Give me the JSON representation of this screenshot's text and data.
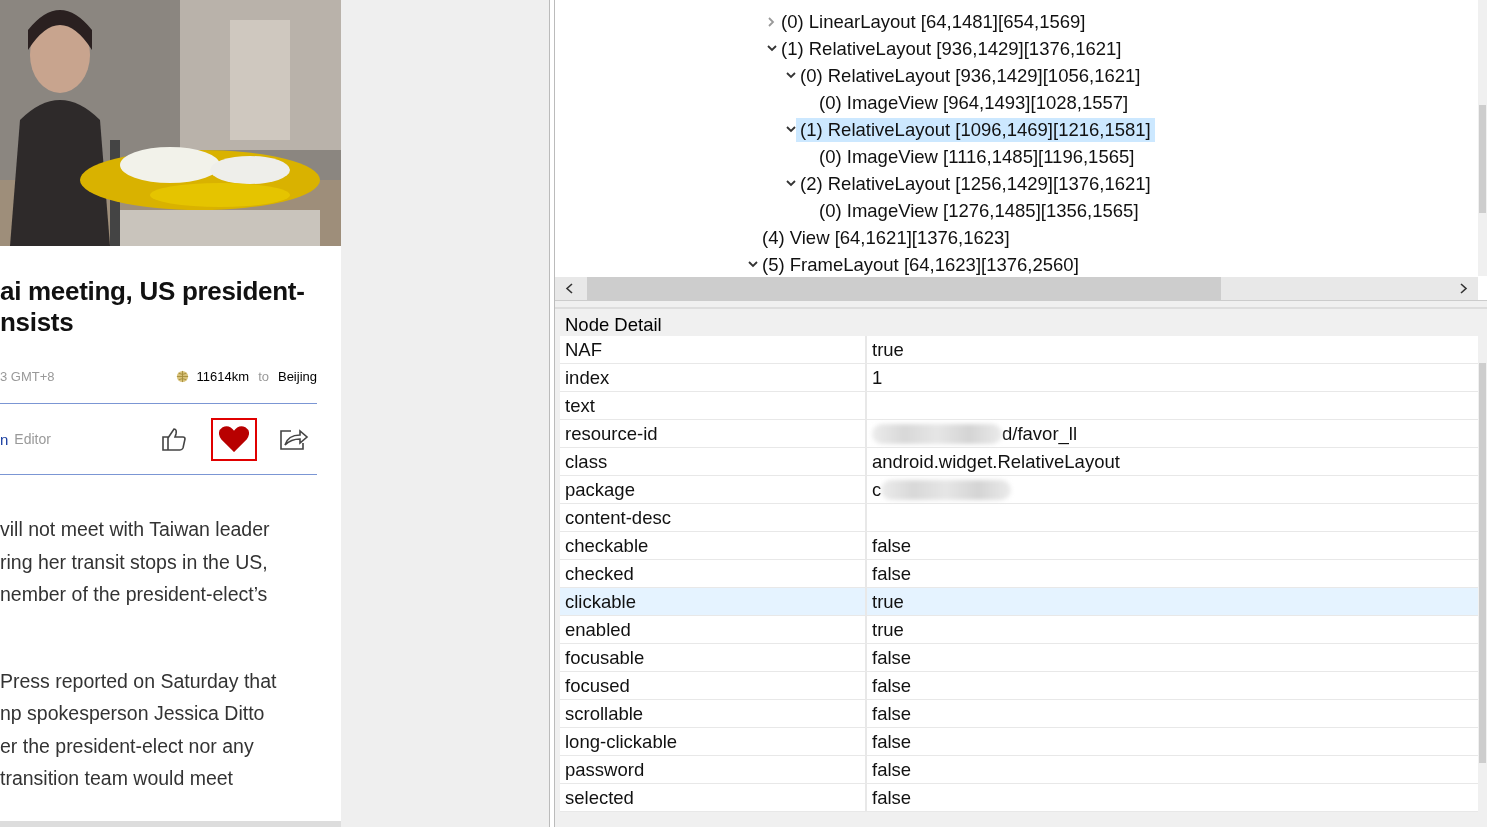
{
  "article": {
    "picture": {
      "kind": "picture"
    },
    "headline": [
      "ai meeting, US president-",
      "nsists"
    ],
    "meta": {
      "time": "3 GMT+8",
      "distance": "11614km",
      "to": "to",
      "city": "Beijing"
    },
    "author": {
      "name": "n",
      "role": "Editor"
    },
    "actions": [
      {
        "kind": "like",
        "selected": false
      },
      {
        "kind": "favorite",
        "selected": true
      },
      {
        "kind": "share",
        "selected": false
      }
    ],
    "paragraphs": [
      {
        "lines": [
          "vill not meet with Taiwan leader",
          "ring her transit stops in the US,",
          "nember of the president-elect’s"
        ]
      },
      {
        "lines": [
          "Press reported on Saturday that",
          "np spokesperson Jessica Ditto",
          "er the president-elect nor any",
          "transition team would meet"
        ]
      }
    ]
  },
  "tree": {
    "nodes": [
      {
        "children": [
          {
            "label": "(0) LinearLayout [64,1481][654,1569]",
            "expanded": false,
            "selected": false
          },
          {
            "label": "(1) RelativeLayout [936,1429][1376,1621]",
            "expanded": true,
            "selected": false,
            "children": [
              {
                "label": "(0) RelativeLayout [936,1429][1056,1621]",
                "expanded": true,
                "selected": false,
                "children": [
                  {
                    "label": "(0) ImageView [964,1493][1028,1557]",
                    "selected": false
                  }
                ]
              },
              {
                "label": "(1) RelativeLayout [1096,1469][1216,1581]",
                "expanded": true,
                "selected": true,
                "children": [
                  {
                    "label": "(0) ImageView [1116,1485][1196,1565]",
                    "selected": false
                  }
                ]
              },
              {
                "label": "(2) RelativeLayout [1256,1429][1376,1621]",
                "expanded": true,
                "selected": false,
                "children": [
                  {
                    "label": "(0) ImageView [1276,1485][1356,1565]",
                    "selected": false
                  }
                ]
              }
            ]
          }
        ]
      },
      {
        "label": "(4) View [64,1621][1376,1623]",
        "selected": false
      },
      {
        "label": "(5) FrameLayout [64,1623][1376,2560]",
        "expanded": true,
        "selected": false
      }
    ]
  },
  "node_detail": {
    "title": "Node Detail",
    "rows": [
      {
        "name": "NAF",
        "value": "true",
        "selected": false
      },
      {
        "name": "index",
        "value": "1",
        "selected": false
      },
      {
        "name": "text",
        "selected": false
      },
      {
        "name": "resource-id",
        "value": "d/favor_ll",
        "kind": "blurstart",
        "selected": false
      },
      {
        "name": "class",
        "value": "android.widget.RelativeLayout",
        "selected": false
      },
      {
        "name": "package",
        "value": "c",
        "kind": "blurend",
        "selected": false
      },
      {
        "name": "content-desc",
        "selected": false
      },
      {
        "name": "checkable",
        "value": "false",
        "selected": false
      },
      {
        "name": "checked",
        "value": "false",
        "selected": false
      },
      {
        "name": "clickable",
        "value": "true",
        "selected": true
      },
      {
        "name": "enabled",
        "value": "true",
        "selected": false
      },
      {
        "name": "focusable",
        "value": "false",
        "selected": false
      },
      {
        "name": "focused",
        "value": "false",
        "selected": false
      },
      {
        "name": "scrollable",
        "value": "false",
        "selected": false
      },
      {
        "name": "long-clickable",
        "value": "false",
        "selected": false
      },
      {
        "name": "password",
        "value": "false",
        "selected": false
      },
      {
        "name": "selected",
        "value": "false",
        "selected": false
      }
    ]
  }
}
